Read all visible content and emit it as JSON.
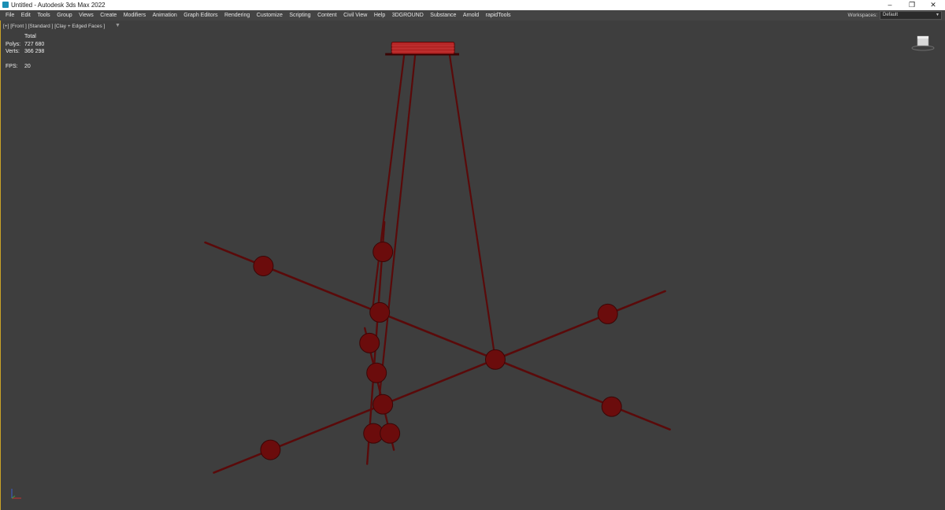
{
  "titlebar": {
    "title": "Untitled - Autodesk 3ds Max 2022",
    "minimize": "–",
    "restore": "❐",
    "close": "✕"
  },
  "menu": {
    "items": [
      "File",
      "Edit",
      "Tools",
      "Group",
      "Views",
      "Create",
      "Modifiers",
      "Animation",
      "Graph Editors",
      "Rendering",
      "Customize",
      "Scripting",
      "Content",
      "Civil View",
      "Help",
      "3DGROUND",
      "Substance",
      "Arnold",
      "rapidTools"
    ],
    "workspaces_label": "Workspaces:",
    "workspace_value": "Default"
  },
  "viewport": {
    "label": "[+] [Front ] [Standard ] [Clay + Edged Faces ]",
    "filter_icon": "filter-icon",
    "stats": {
      "header": "Total",
      "polys_label": "Polys:",
      "polys_value": "727 680",
      "verts_label": "Verts:",
      "verts_value": "366 298",
      "fps_label": "FPS:",
      "fps_value": "20"
    }
  },
  "colors": {
    "viewport_bg": "#3e3e3e",
    "model": "#6b0c0c",
    "model_edge": "#3a0606",
    "menubar": "#444444",
    "active_border": "#c9a227"
  }
}
